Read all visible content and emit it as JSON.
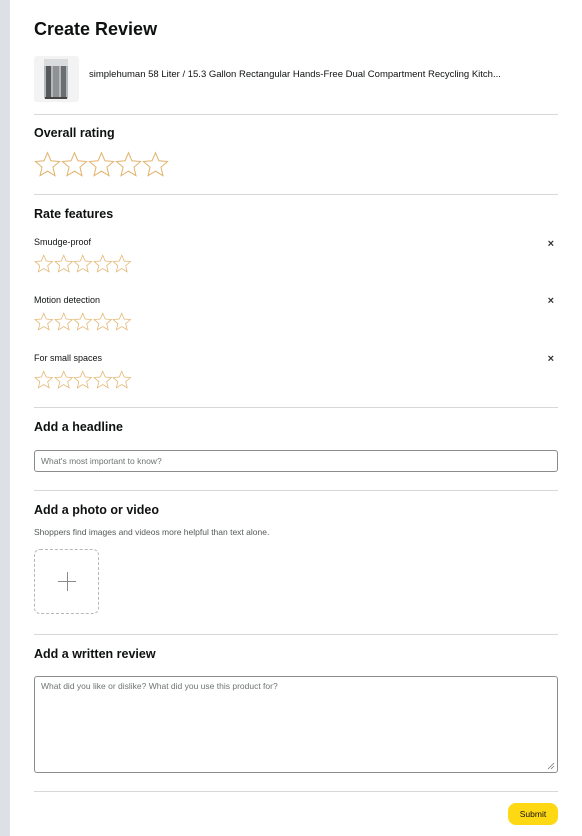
{
  "page": {
    "title": "Create Review"
  },
  "product": {
    "name": "simplehuman 58 Liter / 15.3 Gallon Rectangular Hands-Free Dual Compartment Recycling Kitch..."
  },
  "overall_rating": {
    "title": "Overall rating",
    "stars": 5,
    "rating": 0
  },
  "features": {
    "title": "Rate features",
    "items": [
      {
        "label": "Smudge-proof",
        "rating": 0
      },
      {
        "label": "Motion detection",
        "rating": 0
      },
      {
        "label": "For small spaces",
        "rating": 0
      }
    ],
    "remove_icon": "×"
  },
  "headline": {
    "title": "Add a headline",
    "placeholder": "What's most important to know?"
  },
  "media": {
    "title": "Add a photo or video",
    "helper": "Shoppers find images and videos more helpful than text alone."
  },
  "written_review": {
    "title": "Add a written review",
    "placeholder": "What did you like or dislike? What did you use this product for?"
  },
  "submit": {
    "label": "Submit"
  },
  "colors": {
    "star_outline": "#e3b36c",
    "submit_bg": "#ffd814",
    "divider": "#d5d9d9"
  },
  "icons": {
    "upload": "plus-icon",
    "remove": "close-icon",
    "star": "star-outline-icon"
  }
}
